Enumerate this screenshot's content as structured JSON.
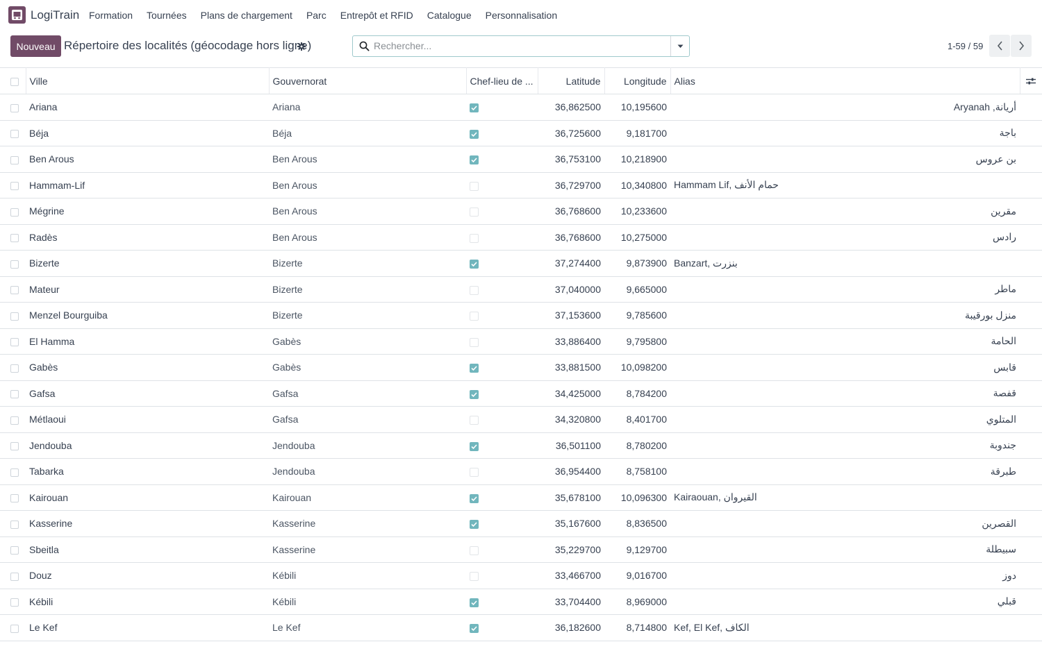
{
  "app": {
    "name": "LogiTrain"
  },
  "nav": {
    "items": [
      {
        "label": "Formation"
      },
      {
        "label": "Tournées"
      },
      {
        "label": "Plans de chargement"
      },
      {
        "label": "Parc"
      },
      {
        "label": "Entrepôt et RFID"
      },
      {
        "label": "Catalogue"
      },
      {
        "label": "Personnalisation"
      }
    ]
  },
  "control": {
    "new_label": "Nouveau",
    "title": "Répertoire des localités (géocodage hors ligne)",
    "search_placeholder": "Rechercher...",
    "pager": "1-59 / 59"
  },
  "table": {
    "columns": {
      "ville": "Ville",
      "gouvernorat": "Gouvernorat",
      "chef_lieu": "Chef-lieu de ...",
      "latitude": "Latitude",
      "longitude": "Longitude",
      "alias": "Alias"
    },
    "rows": [
      {
        "ville": "Ariana",
        "gouvernorat": "Ariana",
        "chef_lieu": true,
        "latitude": "36,862500",
        "longitude": "10,195600",
        "alias": "أريانة, Aryanah"
      },
      {
        "ville": "Béja",
        "gouvernorat": "Béja",
        "chef_lieu": true,
        "latitude": "36,725600",
        "longitude": "9,181700",
        "alias": "باجة"
      },
      {
        "ville": "Ben Arous",
        "gouvernorat": "Ben Arous",
        "chef_lieu": true,
        "latitude": "36,753100",
        "longitude": "10,218900",
        "alias": "بن عروس"
      },
      {
        "ville": "Hammam-Lif",
        "gouvernorat": "Ben Arous",
        "chef_lieu": false,
        "latitude": "36,729700",
        "longitude": "10,340800",
        "alias": "Hammam Lif, حمام الأنف"
      },
      {
        "ville": "Mégrine",
        "gouvernorat": "Ben Arous",
        "chef_lieu": false,
        "latitude": "36,768600",
        "longitude": "10,233600",
        "alias": "مقرين"
      },
      {
        "ville": "Radès",
        "gouvernorat": "Ben Arous",
        "chef_lieu": false,
        "latitude": "36,768600",
        "longitude": "10,275000",
        "alias": "رادس"
      },
      {
        "ville": "Bizerte",
        "gouvernorat": "Bizerte",
        "chef_lieu": true,
        "latitude": "37,274400",
        "longitude": "9,873900",
        "alias": "Banzart, بنزرت"
      },
      {
        "ville": "Mateur",
        "gouvernorat": "Bizerte",
        "chef_lieu": false,
        "latitude": "37,040000",
        "longitude": "9,665000",
        "alias": "ماطر"
      },
      {
        "ville": "Menzel Bourguiba",
        "gouvernorat": "Bizerte",
        "chef_lieu": false,
        "latitude": "37,153600",
        "longitude": "9,785600",
        "alias": "منزل بورقيبة"
      },
      {
        "ville": "El Hamma",
        "gouvernorat": "Gabès",
        "chef_lieu": false,
        "latitude": "33,886400",
        "longitude": "9,795800",
        "alias": "الحامة"
      },
      {
        "ville": "Gabès",
        "gouvernorat": "Gabès",
        "chef_lieu": true,
        "latitude": "33,881500",
        "longitude": "10,098200",
        "alias": "قابس"
      },
      {
        "ville": "Gafsa",
        "gouvernorat": "Gafsa",
        "chef_lieu": true,
        "latitude": "34,425000",
        "longitude": "8,784200",
        "alias": "قفصة"
      },
      {
        "ville": "Métlaoui",
        "gouvernorat": "Gafsa",
        "chef_lieu": false,
        "latitude": "34,320800",
        "longitude": "8,401700",
        "alias": "المتلوي"
      },
      {
        "ville": "Jendouba",
        "gouvernorat": "Jendouba",
        "chef_lieu": true,
        "latitude": "36,501100",
        "longitude": "8,780200",
        "alias": "جندوبة"
      },
      {
        "ville": "Tabarka",
        "gouvernorat": "Jendouba",
        "chef_lieu": false,
        "latitude": "36,954400",
        "longitude": "8,758100",
        "alias": "طبرقة"
      },
      {
        "ville": "Kairouan",
        "gouvernorat": "Kairouan",
        "chef_lieu": true,
        "latitude": "35,678100",
        "longitude": "10,096300",
        "alias": "Kairaouan, القيروان"
      },
      {
        "ville": "Kasserine",
        "gouvernorat": "Kasserine",
        "chef_lieu": true,
        "latitude": "35,167600",
        "longitude": "8,836500",
        "alias": "القصرين"
      },
      {
        "ville": "Sbeitla",
        "gouvernorat": "Kasserine",
        "chef_lieu": false,
        "latitude": "35,229700",
        "longitude": "9,129700",
        "alias": "سبيطلة"
      },
      {
        "ville": "Douz",
        "gouvernorat": "Kébili",
        "chef_lieu": false,
        "latitude": "33,466700",
        "longitude": "9,016700",
        "alias": "دوز"
      },
      {
        "ville": "Kébili",
        "gouvernorat": "Kébili",
        "chef_lieu": true,
        "latitude": "33,704400",
        "longitude": "8,969000",
        "alias": "قبلي"
      },
      {
        "ville": "Le Kef",
        "gouvernorat": "Le Kef",
        "chef_lieu": true,
        "latitude": "36,182600",
        "longitude": "8,714800",
        "alias": "Kef, El Kef, الكاف"
      }
    ]
  },
  "colors": {
    "brand": "#714b67",
    "check": "#71b6bd",
    "focus_border": "#9fc9cc"
  },
  "icons": [
    "app-logo-icon",
    "gear-icon",
    "search-icon",
    "caret-down-icon",
    "chevron-left-icon",
    "chevron-right-icon",
    "optional-columns-icon",
    "checkmark-icon"
  ]
}
